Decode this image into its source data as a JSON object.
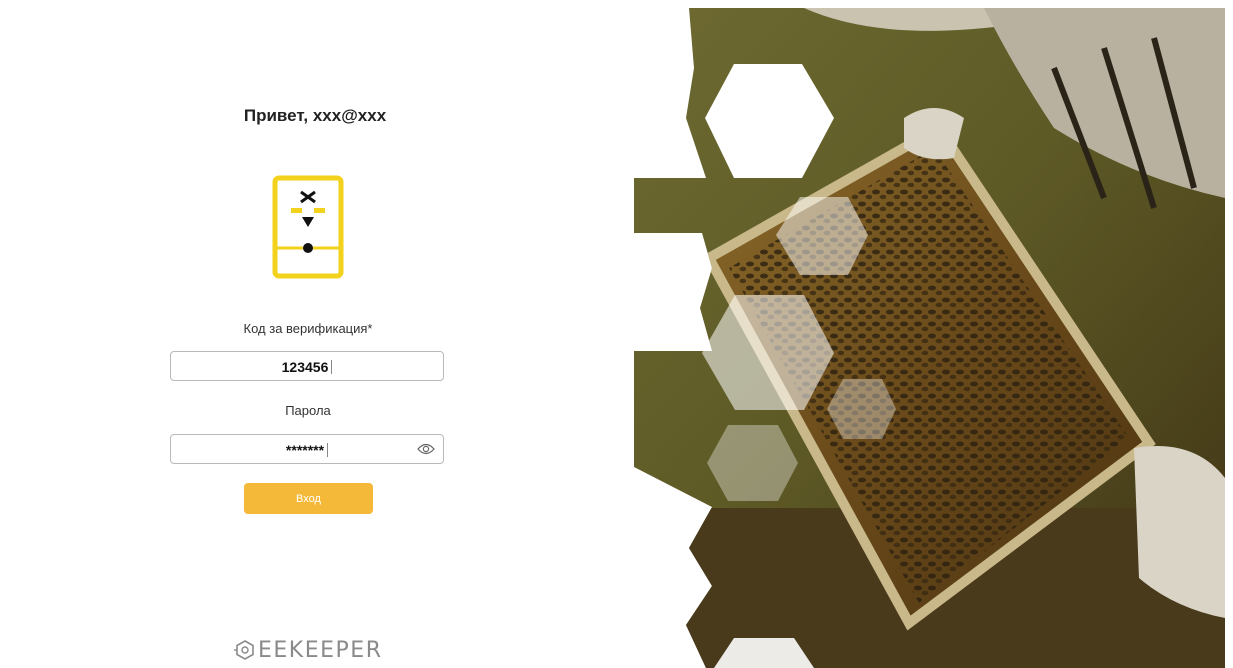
{
  "login": {
    "greeting": "Привет, xxx@xxx",
    "verification_label": "Код за верификация*",
    "verification_value": "123456",
    "password_label": "Парола",
    "password_value": "*******",
    "submit_label": "Вход"
  },
  "logo": {
    "text": "EEKEEPER"
  },
  "icons": {
    "app": "phone-bee-icon",
    "password_toggle": "eye-icon",
    "logo_mark": "bee-logo-icon"
  },
  "colors": {
    "accent": "#f5b93a",
    "icon_yellow": "#f2d21c",
    "photo_amber": "#8a6a1a"
  }
}
